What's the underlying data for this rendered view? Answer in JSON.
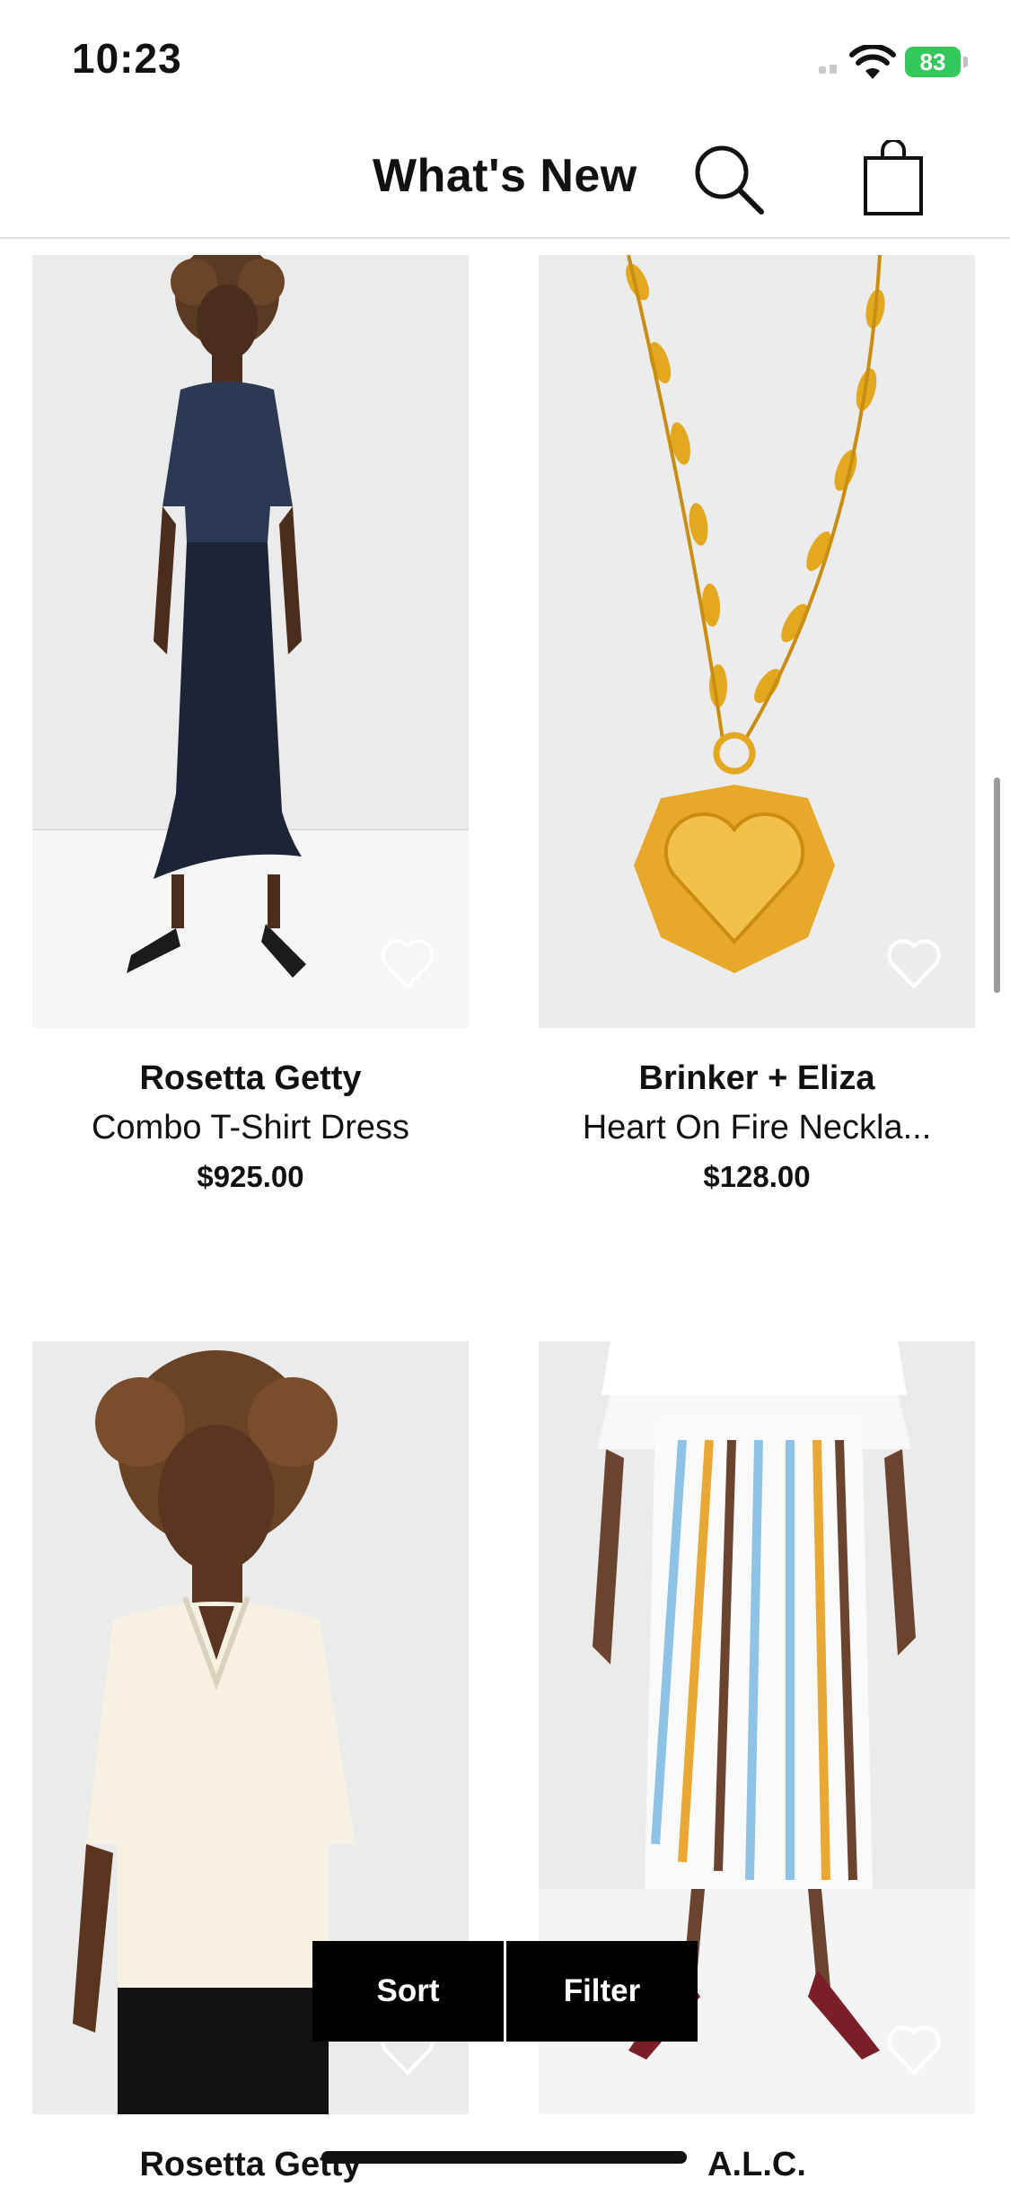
{
  "status": {
    "time": "10:23",
    "battery": "83"
  },
  "header": {
    "title": "What's New"
  },
  "products": [
    {
      "brand": "Rosetta Getty",
      "name": "Combo T-Shirt Dress",
      "price": "$925.00"
    },
    {
      "brand": "Brinker + Eliza",
      "name": "Heart On Fire Neckla...",
      "price": "$128.00"
    },
    {
      "brand": "Rosetta Getty",
      "name": "",
      "price": ""
    },
    {
      "brand": "A.L.C.",
      "name": "",
      "price": ""
    }
  ],
  "actions": {
    "sort": "Sort",
    "filter": "Filter"
  },
  "icons": {
    "search": "search-icon",
    "bag": "shopping-bag-icon",
    "heart": "heart-outline-icon",
    "wifi": "wifi-icon"
  },
  "colors": {
    "battery": "#34c759",
    "button_bg": "#000000"
  }
}
